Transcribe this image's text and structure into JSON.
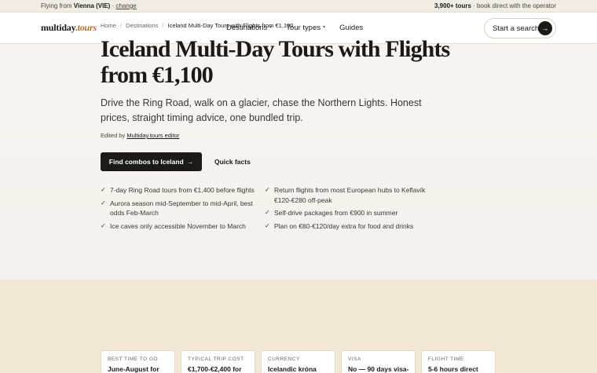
{
  "topbar": {
    "flying_prefix": "Flying from",
    "origin": "Vienna (VIE)",
    "separator": "·",
    "change_link": "change",
    "tour_count": "3,900+ tours",
    "tour_suffix": "· book direct with the operator"
  },
  "nav": {
    "logo_main": "multiday",
    "logo_dot": ".",
    "logo_tld": "tours",
    "items": [
      {
        "label": "Destinations",
        "caret": "▾"
      },
      {
        "label": "Tour types",
        "caret": "▾"
      },
      {
        "label": "Guides",
        "caret": ""
      }
    ],
    "search_label": "Start a search",
    "search_arrow": "→"
  },
  "breadcrumb": {
    "items": [
      "Home",
      "Destinations",
      "Iceland Multi-Day Tours with Flights from €1,100"
    ],
    "separator": "/"
  },
  "hero": {
    "title": "Iceland Multi-Day Tours with Flights from €1,100",
    "lead": "Drive the Ring Road, walk on a glacier, chase the Northern Lights. Honest prices, straight timing advice, one bundled trip.",
    "edited_prefix": "Edited by",
    "editor": "Multiday.tours editor",
    "cta_label": "Find combos to Iceland",
    "cta_arrow": "→",
    "quick_facts_label": "Quick facts"
  },
  "facts": {
    "check_glyph": "✓",
    "left": [
      "7-day Ring Road tours from €1,400 before flights",
      "Aurora season mid-September to mid-April, best odds Feb-March",
      "Ice caves only accessible November to March"
    ],
    "right": [
      "Return flights from most European hubs to Keflavík €120-€280 off-peak",
      "Self-drive packages from €900 in summer",
      "Plan on €80-€120/day extra for food and drinks"
    ]
  },
  "cards": [
    {
      "label": "Best time to go",
      "value": "June-August for"
    },
    {
      "label": "Typical trip cost",
      "value": "€1,700-€2,400 for"
    },
    {
      "label": "Currency",
      "value": "Icelandic króna"
    },
    {
      "label": "Visa",
      "value": "No — 90 days visa-"
    },
    {
      "label": "Flight time",
      "value": "5-6 hours direct"
    }
  ]
}
